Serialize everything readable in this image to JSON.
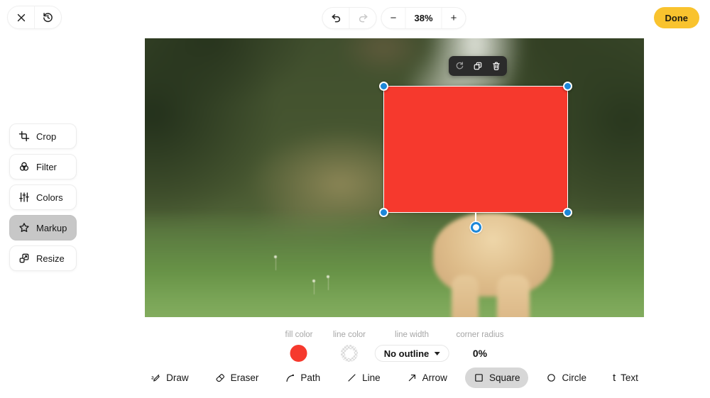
{
  "top_bar": {
    "minus_label": "−",
    "zoom_level": "38%",
    "plus_label": "+",
    "done_label": "Done",
    "icons": [
      "close-icon",
      "history-icon",
      "undo-icon",
      "redo-icon"
    ]
  },
  "sidebar": {
    "items": [
      {
        "label": "Crop",
        "icon": "crop-icon",
        "selected": false
      },
      {
        "label": "Filter",
        "icon": "filter-icon",
        "selected": false
      },
      {
        "label": "Colors",
        "icon": "colors-icon",
        "selected": false
      },
      {
        "label": "Markup",
        "icon": "markup-star-icon",
        "selected": true
      },
      {
        "label": "Resize",
        "icon": "resize-icon",
        "selected": false
      }
    ]
  },
  "selection_toolbar": {
    "buttons": [
      {
        "icon": "rotate-icon",
        "enabled": false
      },
      {
        "icon": "duplicate-icon",
        "enabled": true
      },
      {
        "icon": "delete-icon",
        "enabled": true
      }
    ]
  },
  "canvas_shape": {
    "type": "rectangle",
    "fill": "#f6392d",
    "handle_color": "#1c87d9"
  },
  "markup_controls": {
    "fill_color_label": "fill color",
    "fill_color_value": "#f6392d",
    "line_color_label": "line color",
    "line_color_value": "none",
    "line_width_label": "line width",
    "line_width_value": "No outline",
    "corner_radius_label": "corner radius",
    "corner_radius_value": "0%"
  },
  "tools": {
    "text_tool_glyph": "t",
    "items": [
      {
        "label": "Draw",
        "icon": "draw-icon",
        "selected": false
      },
      {
        "label": "Eraser",
        "icon": "eraser-icon",
        "selected": false
      },
      {
        "label": "Path",
        "icon": "path-icon",
        "selected": false
      },
      {
        "label": "Line",
        "icon": "line-icon",
        "selected": false
      },
      {
        "label": "Arrow",
        "icon": "arrow-icon",
        "selected": false
      },
      {
        "label": "Square",
        "icon": "square-icon",
        "selected": true
      },
      {
        "label": "Circle",
        "icon": "circle-icon",
        "selected": false
      },
      {
        "label": "Text",
        "icon": "text-icon",
        "selected": false
      }
    ]
  },
  "colors": {
    "accent_red": "#f6392d",
    "handle_blue": "#1c87d9",
    "done_yellow": "#f9c32e",
    "selected_grey": "#c7c7c7",
    "toolbar_dark": "#2b2b2b"
  }
}
